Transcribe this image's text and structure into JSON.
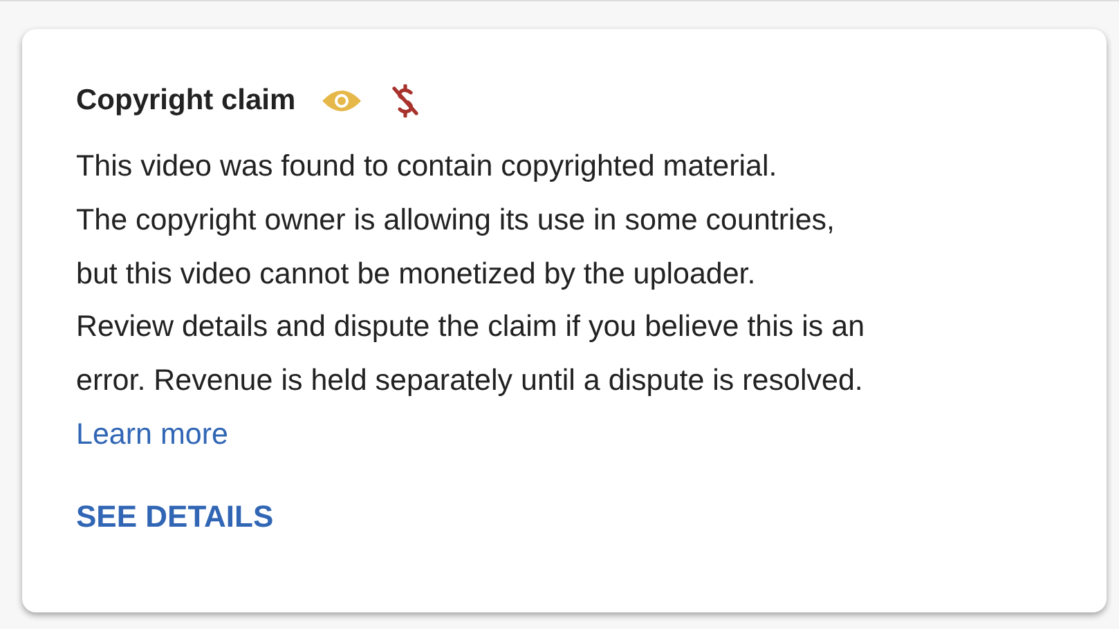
{
  "card": {
    "title": "Copyright claim",
    "message_lines": [
      "This video was found to contain copyrighted material.",
      "The copyright owner is allowing its use in some countries,",
      "but this video cannot be monetized by the uploader.",
      "Review details and dispute the claim if you believe this is an",
      "error. Revenue is held separately until a dispute is resolved."
    ],
    "link": "Learn more",
    "action": "SEE DETAILS"
  }
}
